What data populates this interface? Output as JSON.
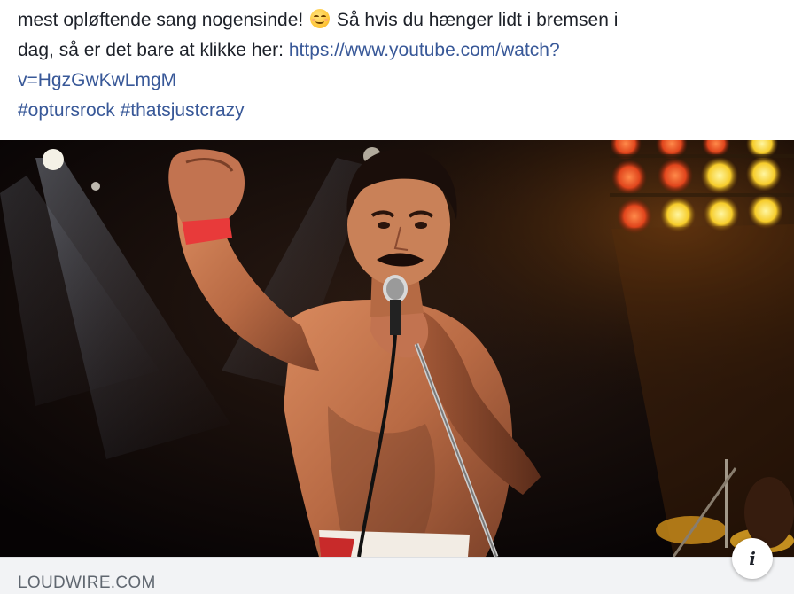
{
  "post": {
    "line1": "mest opløftende sang nogensinde!",
    "line1_after_emoji": " Så hvis du hænger lidt i bremsen i",
    "line2": "dag, så er det bare at klikke her: ",
    "url_part1": "https://www.youtube.com/watch?",
    "url_part2": "v=HgzGwKwLmgM",
    "hashtag1": "#optursrock",
    "hashtag2": "#thatsjustcrazy"
  },
  "emoji": "smiling-face-with-smiling-eyes",
  "link_card": {
    "source": "LOUDWIRE.COM",
    "info_glyph": "i"
  },
  "colors": {
    "text": "#1d2129",
    "link": "#385898",
    "source_bar": "#f2f3f5",
    "source_text": "#606770"
  }
}
